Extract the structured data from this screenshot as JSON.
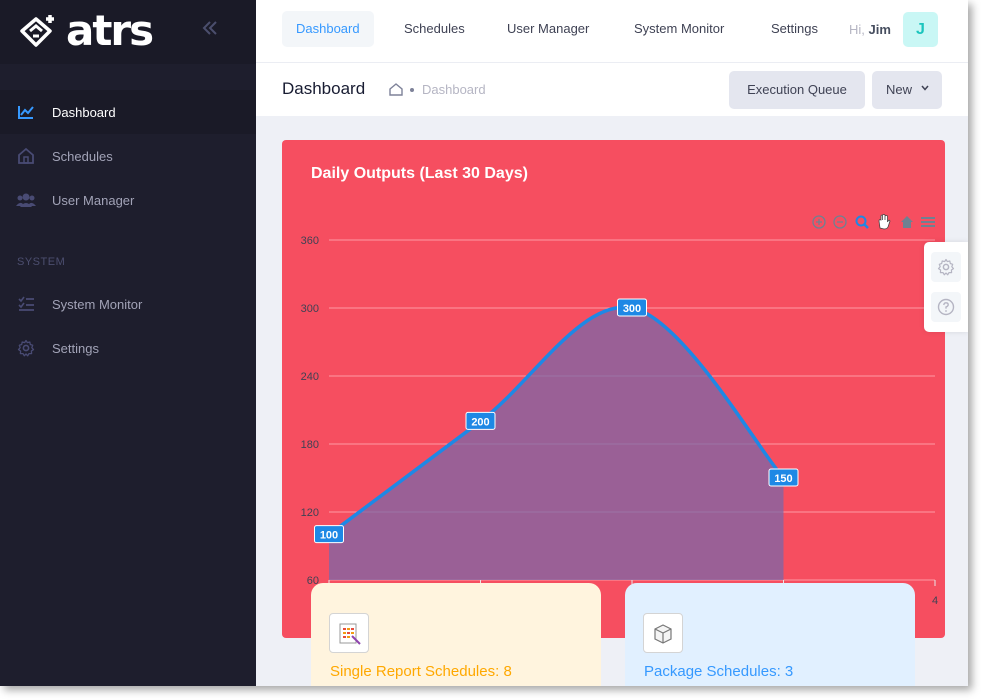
{
  "app": {
    "logo_text": "atrs"
  },
  "sidebar": {
    "items": [
      {
        "label": "Dashboard",
        "active": true
      },
      {
        "label": "Schedules"
      },
      {
        "label": "User Manager"
      }
    ],
    "section_label": "SYSTEM",
    "system_items": [
      {
        "label": "System Monitor"
      },
      {
        "label": "Settings"
      }
    ]
  },
  "topbar": {
    "tabs": [
      {
        "label": "Dashboard",
        "active": true
      },
      {
        "label": "Schedules"
      },
      {
        "label": "User Manager"
      },
      {
        "label": "System Monitor"
      },
      {
        "label": "Settings"
      }
    ],
    "greeting_prefix": "Hi,",
    "user_name": "Jim",
    "avatar_initial": "J"
  },
  "subheader": {
    "title": "Dashboard",
    "breadcrumb": "Dashboard",
    "queue_button": "Execution Queue",
    "new_button": "New"
  },
  "chart_data": {
    "type": "area",
    "title": "Daily Outputs (Last 30 Days)",
    "x": [
      0,
      1,
      2,
      3,
      4
    ],
    "x_tick_labels_visible": [
      "4"
    ],
    "series": [
      {
        "values": [
          100,
          200,
          300,
          150
        ]
      }
    ],
    "data_labels": [
      "100",
      "200",
      "300",
      "150"
    ],
    "y_ticks": [
      60,
      120,
      180,
      240,
      300,
      360
    ],
    "ylim": [
      60,
      360
    ],
    "grid": true,
    "colors": {
      "background": "#f64e60",
      "line": "#1e88e5",
      "fill": "#7b67a8",
      "grid": "#ff9aa5"
    },
    "toolbar_icons": [
      "zoom-in-icon",
      "zoom-out-icon",
      "zoom-icon",
      "pan-icon",
      "reset-home-icon",
      "menu-icon"
    ]
  },
  "stats": [
    {
      "label": "Single Report Schedules: 8",
      "color": "#ffa800"
    },
    {
      "label": "Package Schedules: 3",
      "color": "#3699ff"
    }
  ]
}
